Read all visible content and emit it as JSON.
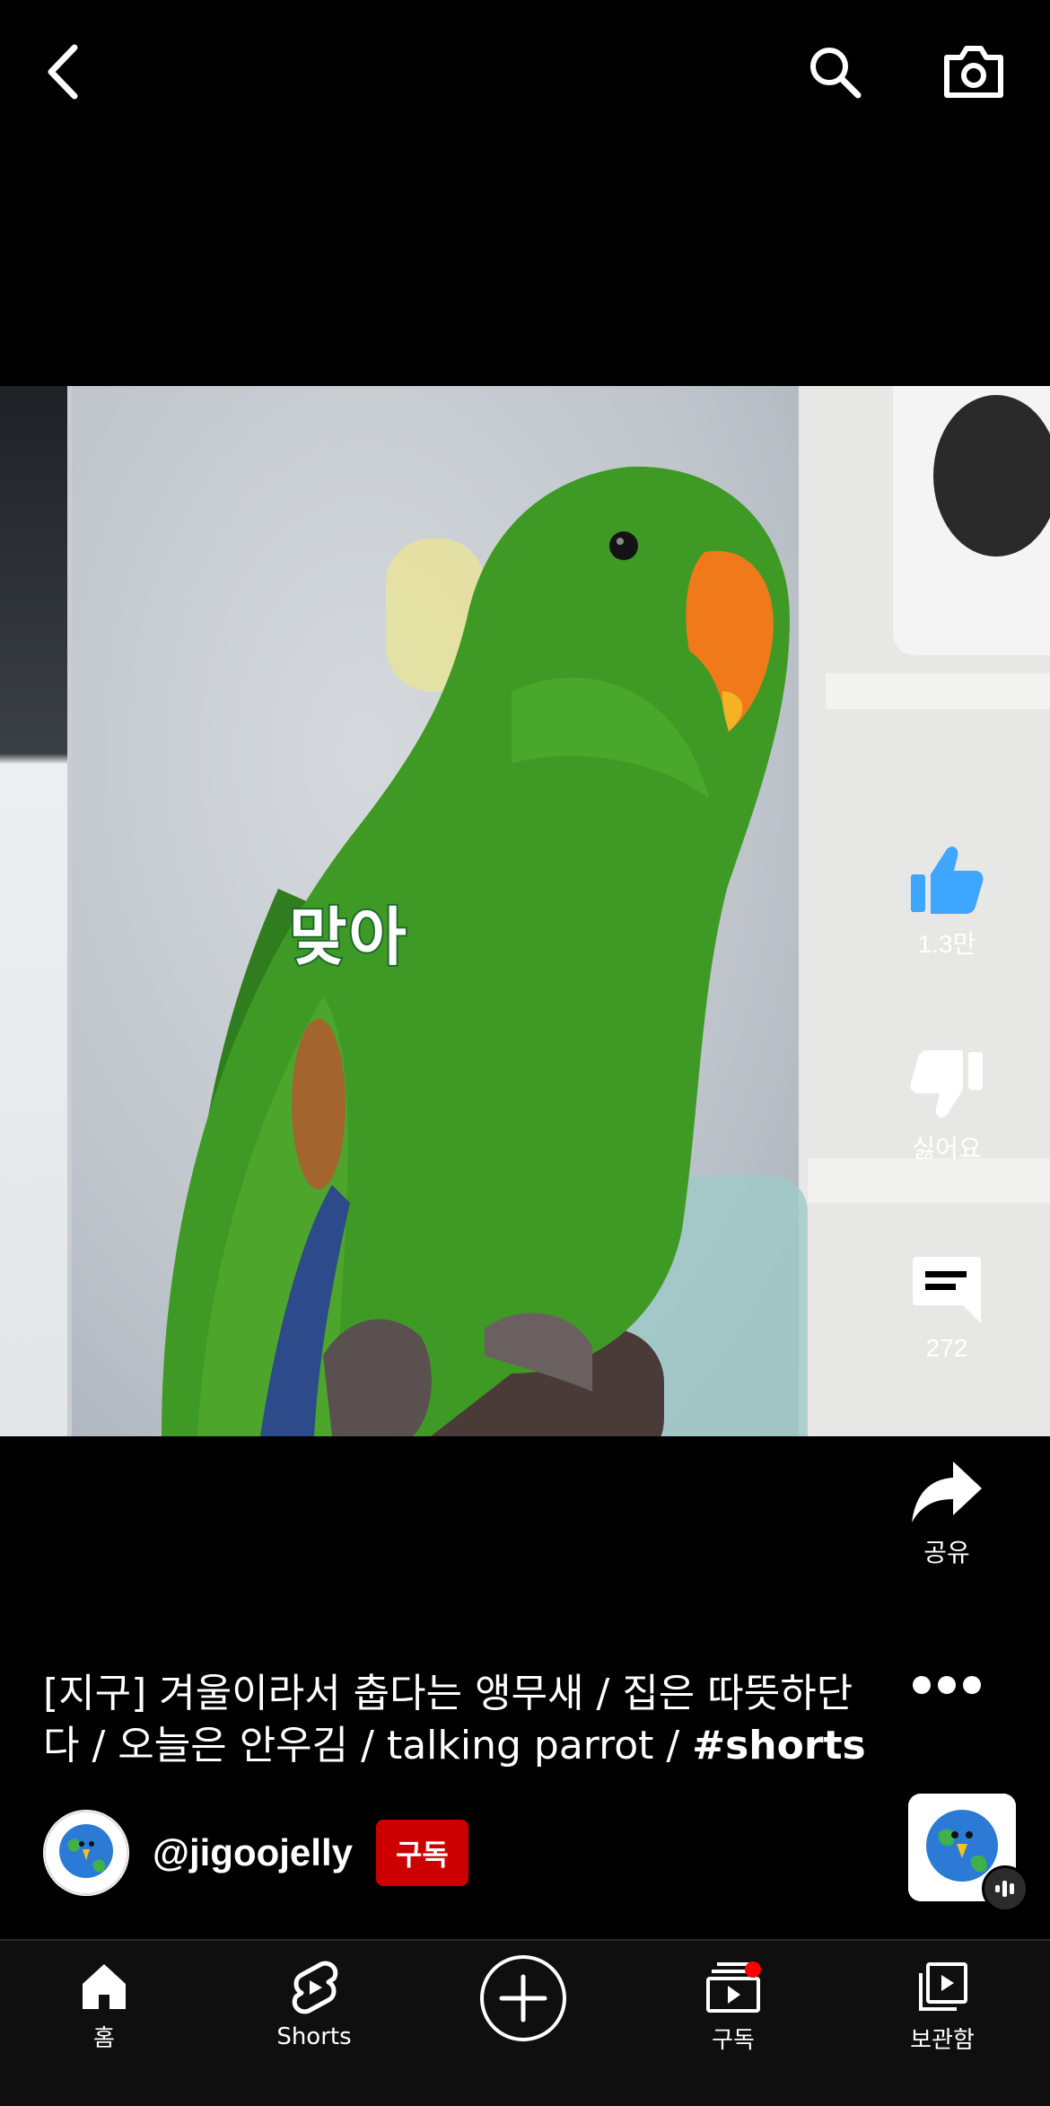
{
  "top_bar": {
    "back_icon": "chevron-left-icon",
    "search_icon": "search-icon",
    "camera_icon": "camera-icon"
  },
  "video": {
    "overlay_caption": "맞아"
  },
  "actions": {
    "like": {
      "icon": "thumbs-up-icon",
      "label": "1.3만",
      "color": "#3ea6ff"
    },
    "dislike": {
      "icon": "thumbs-down-icon",
      "label": "싫어요"
    },
    "comments": {
      "icon": "comment-icon",
      "label": "272"
    },
    "share": {
      "icon": "share-icon",
      "label": "공유"
    },
    "more": {
      "icon": "more-horizontal-icon"
    }
  },
  "video_title": {
    "text": "[지구] 겨울이라서 춥다는 앵무새 / 집은 따뜻하단다 / 오늘은 안우김 / talking parrot / ",
    "hashtag": "#shorts"
  },
  "channel": {
    "handle": "@jigoojelly",
    "subscribe_label": "구독",
    "subscribe_color": "#cc0000"
  },
  "nav": {
    "items": [
      {
        "label": "홈",
        "icon": "home-icon"
      },
      {
        "label": "Shorts",
        "icon": "shorts-icon"
      },
      {
        "label": "",
        "icon": "create-plus-icon"
      },
      {
        "label": "구독",
        "icon": "subscriptions-icon"
      },
      {
        "label": "보관함",
        "icon": "library-icon"
      }
    ]
  }
}
